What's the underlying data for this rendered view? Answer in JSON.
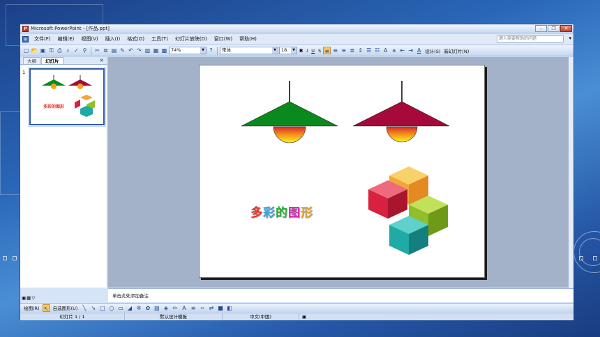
{
  "window": {
    "title": "Microsoft PowerPoint - [作品.ppt]",
    "app_icon": "powerpoint-icon"
  },
  "menubar": {
    "items": [
      {
        "label": "文件(F)"
      },
      {
        "label": "编辑(E)"
      },
      {
        "label": "视图(V)"
      },
      {
        "label": "插入(I)"
      },
      {
        "label": "格式(O)"
      },
      {
        "label": "工具(T)"
      },
      {
        "label": "幻灯片放映(D)"
      },
      {
        "label": "窗口(W)"
      },
      {
        "label": "帮助(H)"
      }
    ],
    "help_placeholder": "键入需要帮助的问题"
  },
  "toolbar": {
    "zoom": "74%",
    "font_name": "宋体",
    "font_size": "18",
    "bold": "B",
    "italic": "I",
    "underline": "U",
    "shadow": "S",
    "design_label": "设计(S)",
    "new_slide_label": "新幻灯片(N)"
  },
  "left_pane": {
    "tabs": [
      {
        "label": "大纲"
      },
      {
        "label": "幻灯片"
      }
    ],
    "active_tab": "幻灯片",
    "slide_number": "1"
  },
  "slide": {
    "title_chars": [
      "多",
      "彩",
      "的",
      "图",
      "形"
    ],
    "title_colors": [
      "#e5332a",
      "#3aa0d8",
      "#2eae3a",
      "#d92ab8",
      "#f2a31b"
    ],
    "lamp_left_color": "#0a8a1e",
    "lamp_right_color": "#a60a3a",
    "cube_colors": {
      "top": "#f2a73a",
      "red": "#d8203f",
      "green": "#8fbf2a",
      "teal": "#1faaa6"
    }
  },
  "notes": {
    "placeholder": "单击此处添加备注"
  },
  "drawbar": {
    "draw_label": "绘图(R)",
    "autoshapes_label": "自选图形(U)"
  },
  "statusbar": {
    "slide_indicator": "幻灯片 1 / 1",
    "template": "默认设计模板",
    "language": "中文(中国)"
  }
}
